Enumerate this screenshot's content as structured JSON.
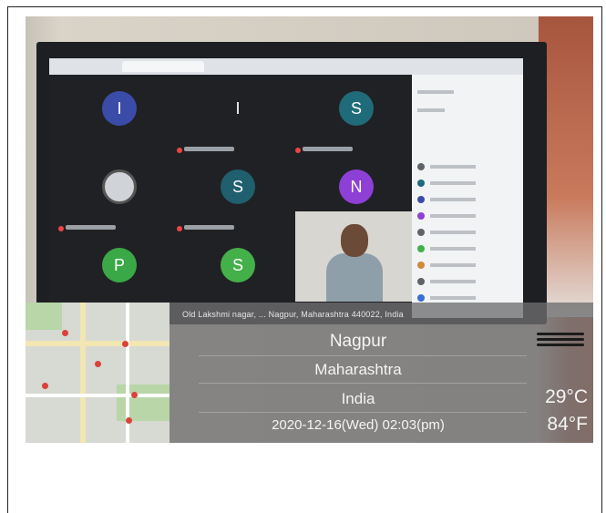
{
  "overlay": {
    "address": "Old Lakshmi nagar, ... Nagpur, Maharashtra 440022, India",
    "city": "Nagpur",
    "state": "Maharashtra",
    "country": "India",
    "datetime": "2020-12-16(Wed)  02:03(pm)",
    "temp_c": "29°C",
    "temp_f": "84°F"
  },
  "meeting": {
    "tiles": [
      {
        "letter": "I",
        "color": "#3b4ba8"
      },
      {
        "letter": "I",
        "color": "#202124"
      },
      {
        "letter": "S",
        "color": "#1f6b7a"
      },
      {
        "letter": "",
        "color": "#d0d4d8"
      },
      {
        "letter": "S",
        "color": "#1f5f6e"
      },
      {
        "letter": "N",
        "color": "#8e3fd6"
      },
      {
        "letter": "P",
        "color": "#3aa847"
      },
      {
        "letter": "S",
        "color": "#44b04a"
      }
    ]
  },
  "colors": {
    "overlay_bg": "#6e6e70",
    "map_bg": "#d7d9d3",
    "pin": "#d9433a"
  }
}
